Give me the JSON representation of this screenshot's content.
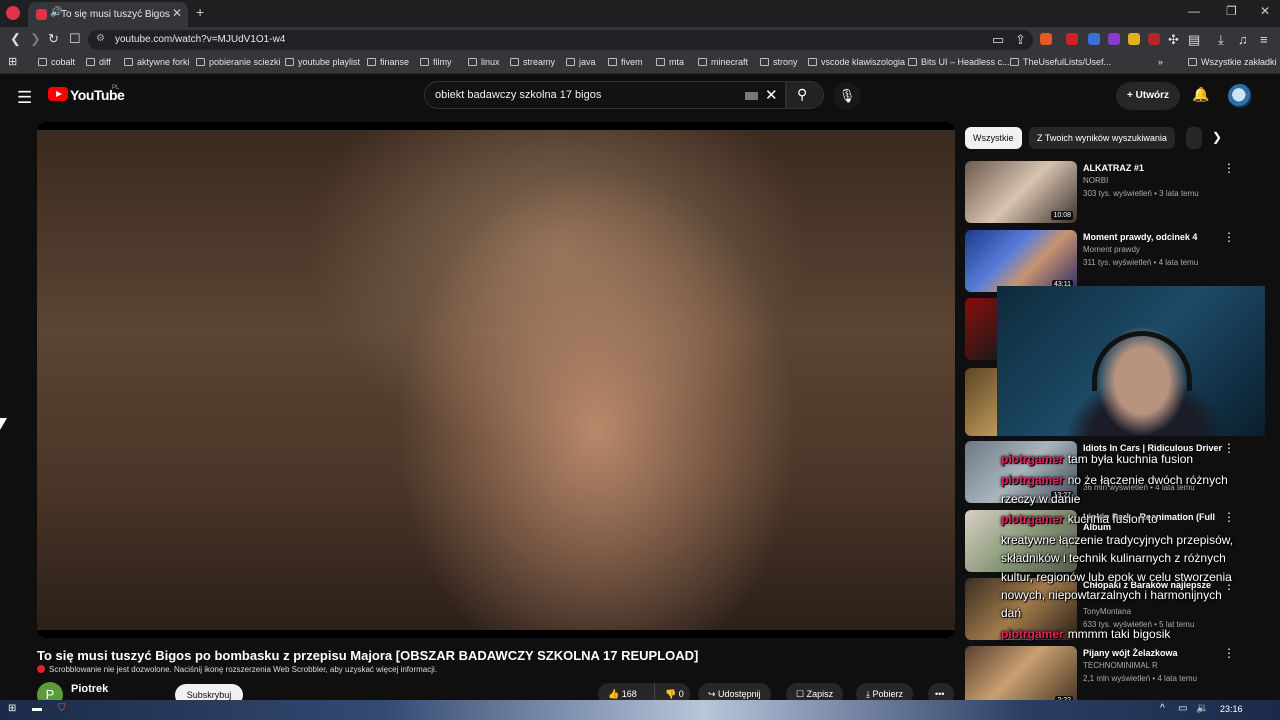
{
  "browser": {
    "tab_title": "To się musi tuszyć Bigos po b",
    "url": "youtube.com/watch?v=MJUdV1O1-w4",
    "all_bookmarks": "Wszystkie zakładki",
    "bookmarks": [
      "cobalt",
      "diff",
      "aktywne forki",
      "pobieranie sciezki",
      "youtube playlist",
      "finanse",
      "filmy",
      "linux",
      "streamy",
      "java",
      "fivem",
      "mta",
      "minecraft",
      "strony",
      "vscode klawiszologia",
      "Bits UI – Headless c...",
      "TheUsefulLists/Usef..."
    ]
  },
  "youtube": {
    "logo_text": "YouTube",
    "region": "PL",
    "search_value": "obiekt badawczy szkolna 17 bigos",
    "create_label": "Utwórz"
  },
  "video": {
    "title": "To się musi tuszyć Bigos po bombasku z przepisu Majora [OBSZAR BADAWCZY SZKOLNA 17 REUPLOAD]",
    "scrobbler_notice": "Scrobblowanie nie jest dozwolone. Naciśnij ikonę rozszerzenia Web Scrobbler, aby uzyskać więcej informacji.",
    "channel_initial": "P",
    "channel_name": "Piotrek",
    "subscribe_label": "Subskrybuj",
    "likes": "168",
    "dislikes": "0",
    "share_label": "Udostępnij",
    "save_label": "Zapisz",
    "download_label": "Pobierz"
  },
  "chips": [
    "Wszystkie",
    "Z Twoich wyników wyszukiwania"
  ],
  "recommendations": [
    {
      "title": "ALKATRAZ #1",
      "channel": "NORBI",
      "meta": "303 tys. wyświetleń • 3 lata temu",
      "duration": "10:08"
    },
    {
      "title": "Moment prawdy, odcinek 4",
      "channel": "Moment prawdy",
      "meta": "311 tys. wyświetleń • 4 lata temu",
      "duration": "43:11"
    },
    {
      "title": "Idiots In Cars | Ridiculous Driver",
      "channel": "",
      "meta": "36 mln wyświetleń • 4 lata temu",
      "duration": "13:27"
    },
    {
      "title": "Linkin Park - Reanimation (Full Album",
      "channel": "",
      "meta": "",
      "duration": ""
    },
    {
      "title": "Chłopaki z Baraków najlepsze",
      "channel": "TonyMontana",
      "meta": "633 tys. wyświetleń • 5 lat temu",
      "duration": ""
    },
    {
      "title": "Pijany wójt Żelazkowa",
      "channel": "TECHNOMINIMAL R",
      "meta": "2,1 mln wyświetleń • 4 lata temu",
      "duration": "2:22"
    }
  ],
  "chat": [
    {
      "user": "piotrgamer",
      "text": "tam była kuchnia fusion"
    },
    {
      "user": "piotrgamer",
      "text": "no że łączenie dwóch różnych"
    },
    {
      "user": "",
      "text": "rzeczy w danie"
    },
    {
      "user": "piotrgamer",
      "text": "kuchnia fusion to"
    },
    {
      "user": "",
      "text": "kreatywne łączenie tradycyjnych przepisów,"
    },
    {
      "user": "",
      "text": "składników i technik kulinarnych z różnych"
    },
    {
      "user": "",
      "text": "kultur, regionów lub epok w celu stworzenia"
    },
    {
      "user": "",
      "text": "nowych, niepowtarzalnych i harmonijnych"
    },
    {
      "user": "",
      "text": "dań"
    },
    {
      "user": "piotrgamer",
      "text": "mmmm taki bigosik"
    }
  ],
  "taskbar": {
    "time": "23:16"
  }
}
